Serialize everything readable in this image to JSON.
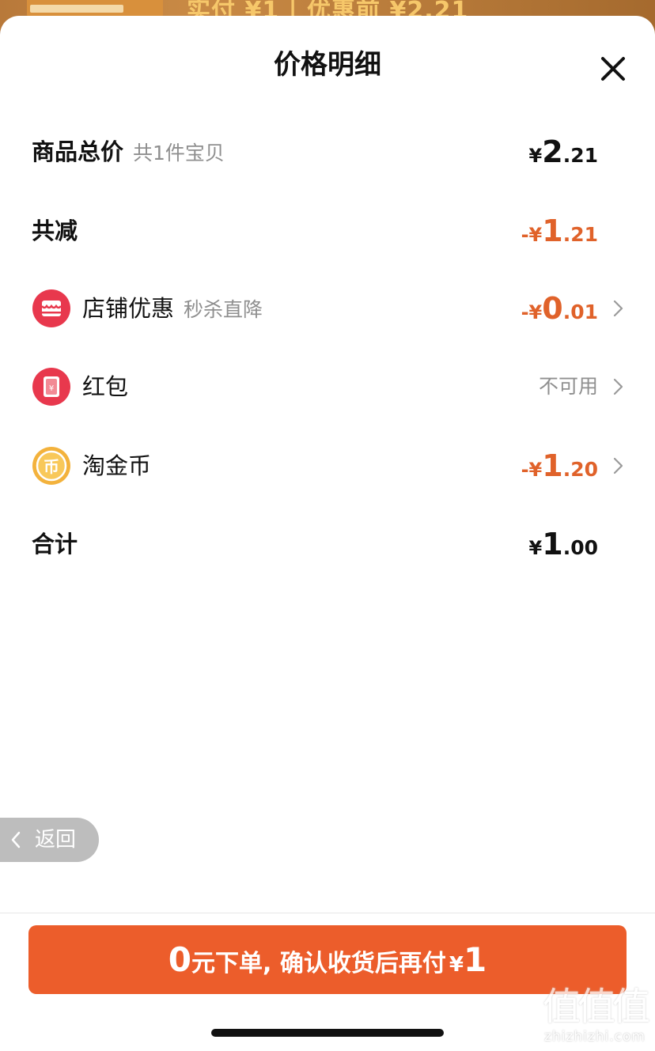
{
  "background": {
    "peek_text": "实付 ¥1 | 优惠前 ¥2.21"
  },
  "sheet": {
    "title": "价格明细",
    "close_icon": "close-icon"
  },
  "rows": {
    "subtotal": {
      "label": "商品总价",
      "sub": "共1件宝贝",
      "amount": {
        "sym": "¥",
        "int": "2",
        "dec": ".21"
      }
    },
    "total_discount": {
      "label": "共减",
      "amount": {
        "sym": "-¥",
        "int": "1",
        "dec": ".21"
      }
    },
    "shop_discount": {
      "icon": "store-icon",
      "label": "店铺优惠",
      "sub": "秒杀直降",
      "amount": {
        "sym": "-¥",
        "int": "0",
        "dec": ".01"
      }
    },
    "red_packet": {
      "icon": "red-packet-icon",
      "label": "红包",
      "status": "不可用"
    },
    "taojinbi": {
      "icon": "coin-icon",
      "coin_char": "币",
      "label": "淘金币",
      "amount": {
        "sym": "-¥",
        "int": "1",
        "dec": ".20"
      }
    },
    "total": {
      "label": "合计",
      "amount": {
        "sym": "¥",
        "int": "1",
        "dec": ".00"
      }
    }
  },
  "back_button": {
    "label": "返回"
  },
  "cta": {
    "zero": "0",
    "text": "元下单, 确认收货后再付",
    "yen": "¥",
    "amount": "1"
  },
  "watermark": {
    "logo": "值值值",
    "url": "zhizhizhi.com"
  },
  "colors": {
    "accent_orange": "#e0622a",
    "cta_orange": "#ec5d2b",
    "store_icon_red": "#e8384d",
    "coin_gold": "#f3b23c"
  }
}
